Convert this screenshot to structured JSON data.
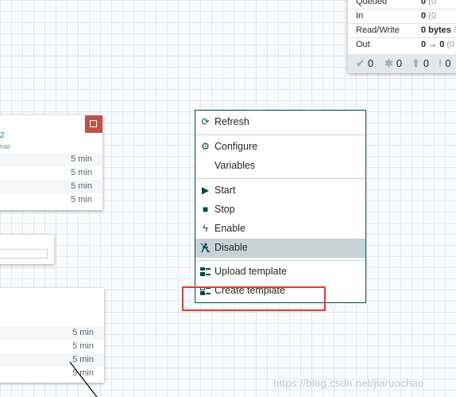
{
  "status_card": {
    "rows": [
      {
        "key": "Queued",
        "value_bold": "0",
        "value_rest": " (0"
      },
      {
        "key": "In",
        "value_bold": "0",
        "value_rest": " (0"
      },
      {
        "key": "Read/Write",
        "value_bold": "0 bytes",
        "value_rest": " /"
      },
      {
        "key": "Out",
        "value_bold": "0 → 0",
        "value_rest": " (0"
      }
    ],
    "icon_counts": [
      {
        "icon": "check-icon",
        "glyph": "✔",
        "count": "0"
      },
      {
        "icon": "asterisk-icon",
        "glyph": "✱",
        "count": "0"
      },
      {
        "icon": "up-arrow-circle-icon",
        "glyph": "⬆",
        "count": "0"
      },
      {
        "icon": "exclamation-circle-icon",
        "glyph": "!",
        "count": "0"
      }
    ]
  },
  "left_processor_1": {
    "name_fragment": "2",
    "sub_fragment": "nar",
    "rows": [
      "5 min",
      "5 min",
      "5 min",
      "5 min"
    ]
  },
  "left_processor_2": {
    "rows": [
      "5 min",
      "5 min",
      "5 min",
      "5 min"
    ]
  },
  "context_menu": {
    "items": [
      {
        "label": "Refresh",
        "icon": "refresh-icon",
        "glyph": "⟳"
      },
      {
        "label": "Configure",
        "icon": "gear-icon",
        "glyph": "⚙"
      },
      {
        "label": "Variables",
        "icon": "",
        "glyph": ""
      },
      {
        "label": "Start",
        "icon": "play-icon",
        "glyph": "▶"
      },
      {
        "label": "Stop",
        "icon": "stop-icon",
        "glyph": "■"
      },
      {
        "label": "Enable",
        "icon": "lightning-icon",
        "glyph": "ϟ"
      },
      {
        "label": "Disable",
        "icon": "disable-icon",
        "glyph": "🚫"
      },
      {
        "label": "Upload template",
        "icon": "upload-template-icon",
        "glyph": "⊞"
      },
      {
        "label": "Create template",
        "icon": "create-template-icon",
        "glyph": "⊟"
      }
    ],
    "selected": "Disable"
  },
  "watermark": "https://blog.csdn.net/jiaruochao",
  "colors": {
    "accent": "#004849",
    "highlight_border": "#e53935",
    "selected_bg": "#c7d2d7",
    "bulletin": "#ba554a"
  }
}
